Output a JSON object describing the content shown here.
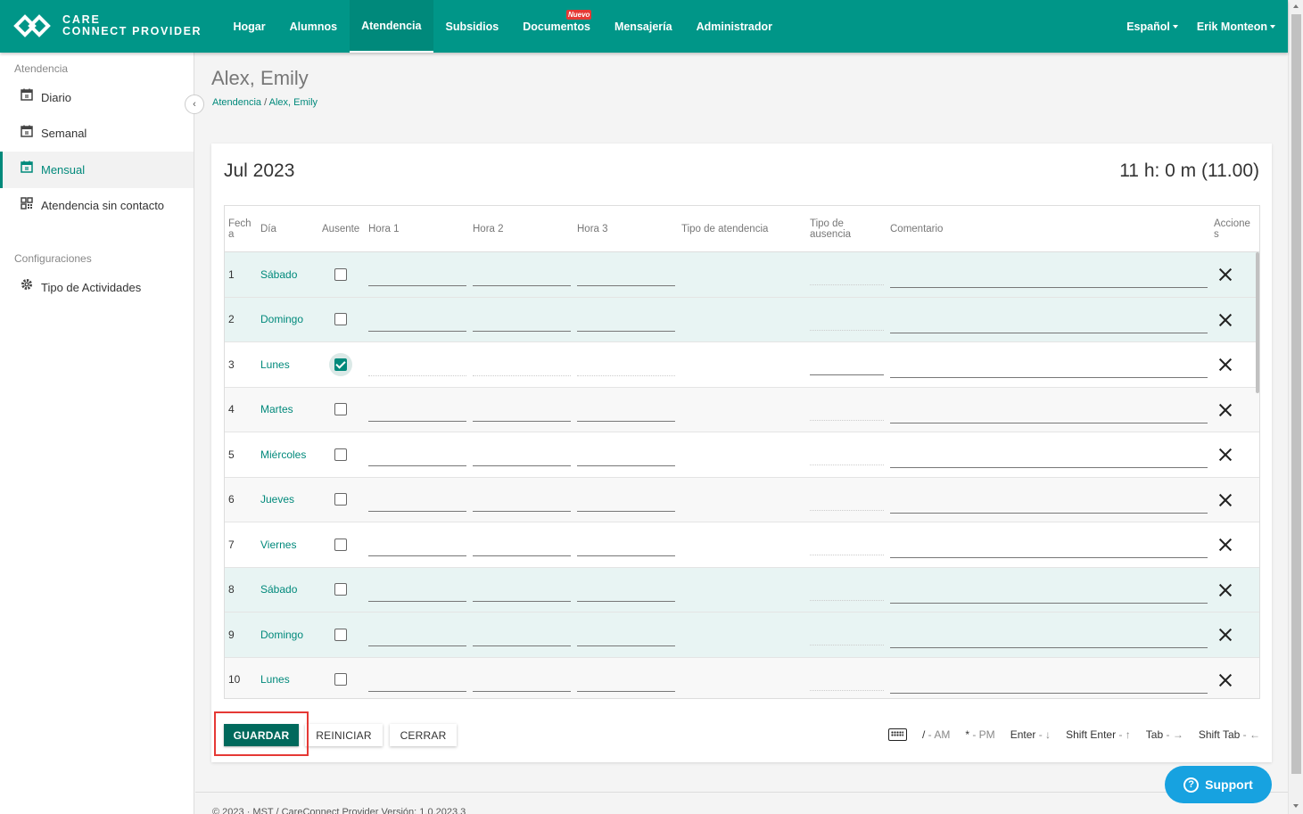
{
  "brand": {
    "line1": "CARE",
    "line2": "CONNECT PROVIDER"
  },
  "nav": {
    "items": [
      {
        "label": "Hogar",
        "active": false
      },
      {
        "label": "Alumnos",
        "active": false
      },
      {
        "label": "Atendencia",
        "active": true
      },
      {
        "label": "Subsidios",
        "active": false
      },
      {
        "label": "Documentos",
        "active": false,
        "badge": "Nuevo"
      },
      {
        "label": "Mensajería",
        "active": false
      },
      {
        "label": "Administrador",
        "active": false
      }
    ],
    "language": "Español",
    "user": "Erik Monteon"
  },
  "sidebar": {
    "section1": "Atendencia",
    "items": [
      {
        "label": "Diario",
        "icon": "calendar-day-icon",
        "active": false
      },
      {
        "label": "Semanal",
        "icon": "calendar-week-icon",
        "active": false
      },
      {
        "label": "Mensual",
        "icon": "calendar-month-icon",
        "active": true
      },
      {
        "label": "Atendencia sin contacto",
        "icon": "qr-code-icon",
        "active": false
      }
    ],
    "section2": "Configuraciones",
    "items2": [
      {
        "label": "Tipo de Actividades",
        "icon": "gear-icon"
      }
    ]
  },
  "page": {
    "title": "Alex, Emily",
    "breadcrumb": {
      "parent": "Atendencia",
      "separator": "/",
      "current": "Alex, Emily"
    }
  },
  "card": {
    "month": "Jul 2023",
    "total": "11 h: 0 m (11.00)"
  },
  "table": {
    "headers": {
      "fecha": "Fecha",
      "dia": "Día",
      "ausente": "Ausente",
      "hora1": "Hora 1",
      "hora2": "Hora 2",
      "hora3": "Hora 3",
      "tipo_atendencia": "Tipo de atendencia",
      "tipo_ausencia": "Tipo de ausencia",
      "comentario": "Comentario",
      "acciones": "Acciones"
    },
    "rows": [
      {
        "fecha": "1",
        "dia": "Sábado",
        "ausente": false,
        "weekend": true
      },
      {
        "fecha": "2",
        "dia": "Domingo",
        "ausente": false,
        "weekend": true
      },
      {
        "fecha": "3",
        "dia": "Lunes",
        "ausente": true,
        "weekend": false
      },
      {
        "fecha": "4",
        "dia": "Martes",
        "ausente": false,
        "weekend": false
      },
      {
        "fecha": "5",
        "dia": "Miércoles",
        "ausente": false,
        "weekend": false
      },
      {
        "fecha": "6",
        "dia": "Jueves",
        "ausente": false,
        "weekend": false
      },
      {
        "fecha": "7",
        "dia": "Viernes",
        "ausente": false,
        "weekend": false
      },
      {
        "fecha": "8",
        "dia": "Sábado",
        "ausente": false,
        "weekend": true
      },
      {
        "fecha": "9",
        "dia": "Domingo",
        "ausente": false,
        "weekend": true
      },
      {
        "fecha": "10",
        "dia": "Lunes",
        "ausente": false,
        "weekend": false
      }
    ]
  },
  "actions": {
    "save": "GUARDAR",
    "reset": "REINICIAR",
    "close": "CERRAR"
  },
  "shortcuts": [
    {
      "key": "/",
      "desc": "- AM"
    },
    {
      "key": "*",
      "desc": "- PM"
    },
    {
      "key": "Enter",
      "desc": "- ↓"
    },
    {
      "key": "Shift Enter",
      "desc": "- ↑"
    },
    {
      "key": "Tab",
      "desc": "- →"
    },
    {
      "key": "Shift Tab",
      "desc": "- ←"
    }
  ],
  "footer": {
    "text": "© 2023 · MST / CareConnect Provider Versión: 1.0.2023.3"
  },
  "support": {
    "label": "Support"
  },
  "colors": {
    "primary": "#009688",
    "accent": "#00695c",
    "support": "#17a2e0",
    "highlight": "#e53935"
  }
}
